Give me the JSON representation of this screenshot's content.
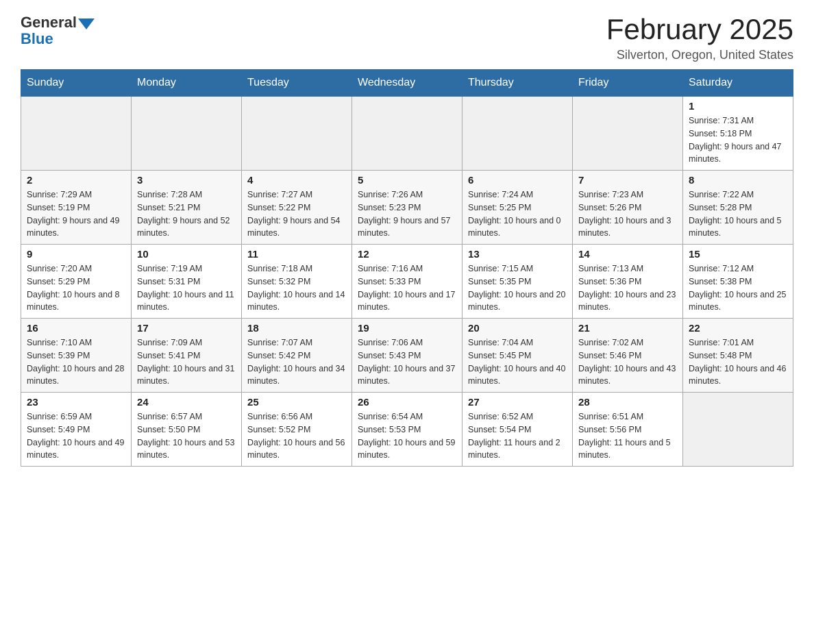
{
  "header": {
    "logo_general": "General",
    "logo_blue": "Blue",
    "title": "February 2025",
    "subtitle": "Silverton, Oregon, United States"
  },
  "weekdays": [
    "Sunday",
    "Monday",
    "Tuesday",
    "Wednesday",
    "Thursday",
    "Friday",
    "Saturday"
  ],
  "weeks": [
    [
      {
        "day": "",
        "info": ""
      },
      {
        "day": "",
        "info": ""
      },
      {
        "day": "",
        "info": ""
      },
      {
        "day": "",
        "info": ""
      },
      {
        "day": "",
        "info": ""
      },
      {
        "day": "",
        "info": ""
      },
      {
        "day": "1",
        "info": "Sunrise: 7:31 AM\nSunset: 5:18 PM\nDaylight: 9 hours and 47 minutes."
      }
    ],
    [
      {
        "day": "2",
        "info": "Sunrise: 7:29 AM\nSunset: 5:19 PM\nDaylight: 9 hours and 49 minutes."
      },
      {
        "day": "3",
        "info": "Sunrise: 7:28 AM\nSunset: 5:21 PM\nDaylight: 9 hours and 52 minutes."
      },
      {
        "day": "4",
        "info": "Sunrise: 7:27 AM\nSunset: 5:22 PM\nDaylight: 9 hours and 54 minutes."
      },
      {
        "day": "5",
        "info": "Sunrise: 7:26 AM\nSunset: 5:23 PM\nDaylight: 9 hours and 57 minutes."
      },
      {
        "day": "6",
        "info": "Sunrise: 7:24 AM\nSunset: 5:25 PM\nDaylight: 10 hours and 0 minutes."
      },
      {
        "day": "7",
        "info": "Sunrise: 7:23 AM\nSunset: 5:26 PM\nDaylight: 10 hours and 3 minutes."
      },
      {
        "day": "8",
        "info": "Sunrise: 7:22 AM\nSunset: 5:28 PM\nDaylight: 10 hours and 5 minutes."
      }
    ],
    [
      {
        "day": "9",
        "info": "Sunrise: 7:20 AM\nSunset: 5:29 PM\nDaylight: 10 hours and 8 minutes."
      },
      {
        "day": "10",
        "info": "Sunrise: 7:19 AM\nSunset: 5:31 PM\nDaylight: 10 hours and 11 minutes."
      },
      {
        "day": "11",
        "info": "Sunrise: 7:18 AM\nSunset: 5:32 PM\nDaylight: 10 hours and 14 minutes."
      },
      {
        "day": "12",
        "info": "Sunrise: 7:16 AM\nSunset: 5:33 PM\nDaylight: 10 hours and 17 minutes."
      },
      {
        "day": "13",
        "info": "Sunrise: 7:15 AM\nSunset: 5:35 PM\nDaylight: 10 hours and 20 minutes."
      },
      {
        "day": "14",
        "info": "Sunrise: 7:13 AM\nSunset: 5:36 PM\nDaylight: 10 hours and 23 minutes."
      },
      {
        "day": "15",
        "info": "Sunrise: 7:12 AM\nSunset: 5:38 PM\nDaylight: 10 hours and 25 minutes."
      }
    ],
    [
      {
        "day": "16",
        "info": "Sunrise: 7:10 AM\nSunset: 5:39 PM\nDaylight: 10 hours and 28 minutes."
      },
      {
        "day": "17",
        "info": "Sunrise: 7:09 AM\nSunset: 5:41 PM\nDaylight: 10 hours and 31 minutes."
      },
      {
        "day": "18",
        "info": "Sunrise: 7:07 AM\nSunset: 5:42 PM\nDaylight: 10 hours and 34 minutes."
      },
      {
        "day": "19",
        "info": "Sunrise: 7:06 AM\nSunset: 5:43 PM\nDaylight: 10 hours and 37 minutes."
      },
      {
        "day": "20",
        "info": "Sunrise: 7:04 AM\nSunset: 5:45 PM\nDaylight: 10 hours and 40 minutes."
      },
      {
        "day": "21",
        "info": "Sunrise: 7:02 AM\nSunset: 5:46 PM\nDaylight: 10 hours and 43 minutes."
      },
      {
        "day": "22",
        "info": "Sunrise: 7:01 AM\nSunset: 5:48 PM\nDaylight: 10 hours and 46 minutes."
      }
    ],
    [
      {
        "day": "23",
        "info": "Sunrise: 6:59 AM\nSunset: 5:49 PM\nDaylight: 10 hours and 49 minutes."
      },
      {
        "day": "24",
        "info": "Sunrise: 6:57 AM\nSunset: 5:50 PM\nDaylight: 10 hours and 53 minutes."
      },
      {
        "day": "25",
        "info": "Sunrise: 6:56 AM\nSunset: 5:52 PM\nDaylight: 10 hours and 56 minutes."
      },
      {
        "day": "26",
        "info": "Sunrise: 6:54 AM\nSunset: 5:53 PM\nDaylight: 10 hours and 59 minutes."
      },
      {
        "day": "27",
        "info": "Sunrise: 6:52 AM\nSunset: 5:54 PM\nDaylight: 11 hours and 2 minutes."
      },
      {
        "day": "28",
        "info": "Sunrise: 6:51 AM\nSunset: 5:56 PM\nDaylight: 11 hours and 5 minutes."
      },
      {
        "day": "",
        "info": ""
      }
    ]
  ]
}
